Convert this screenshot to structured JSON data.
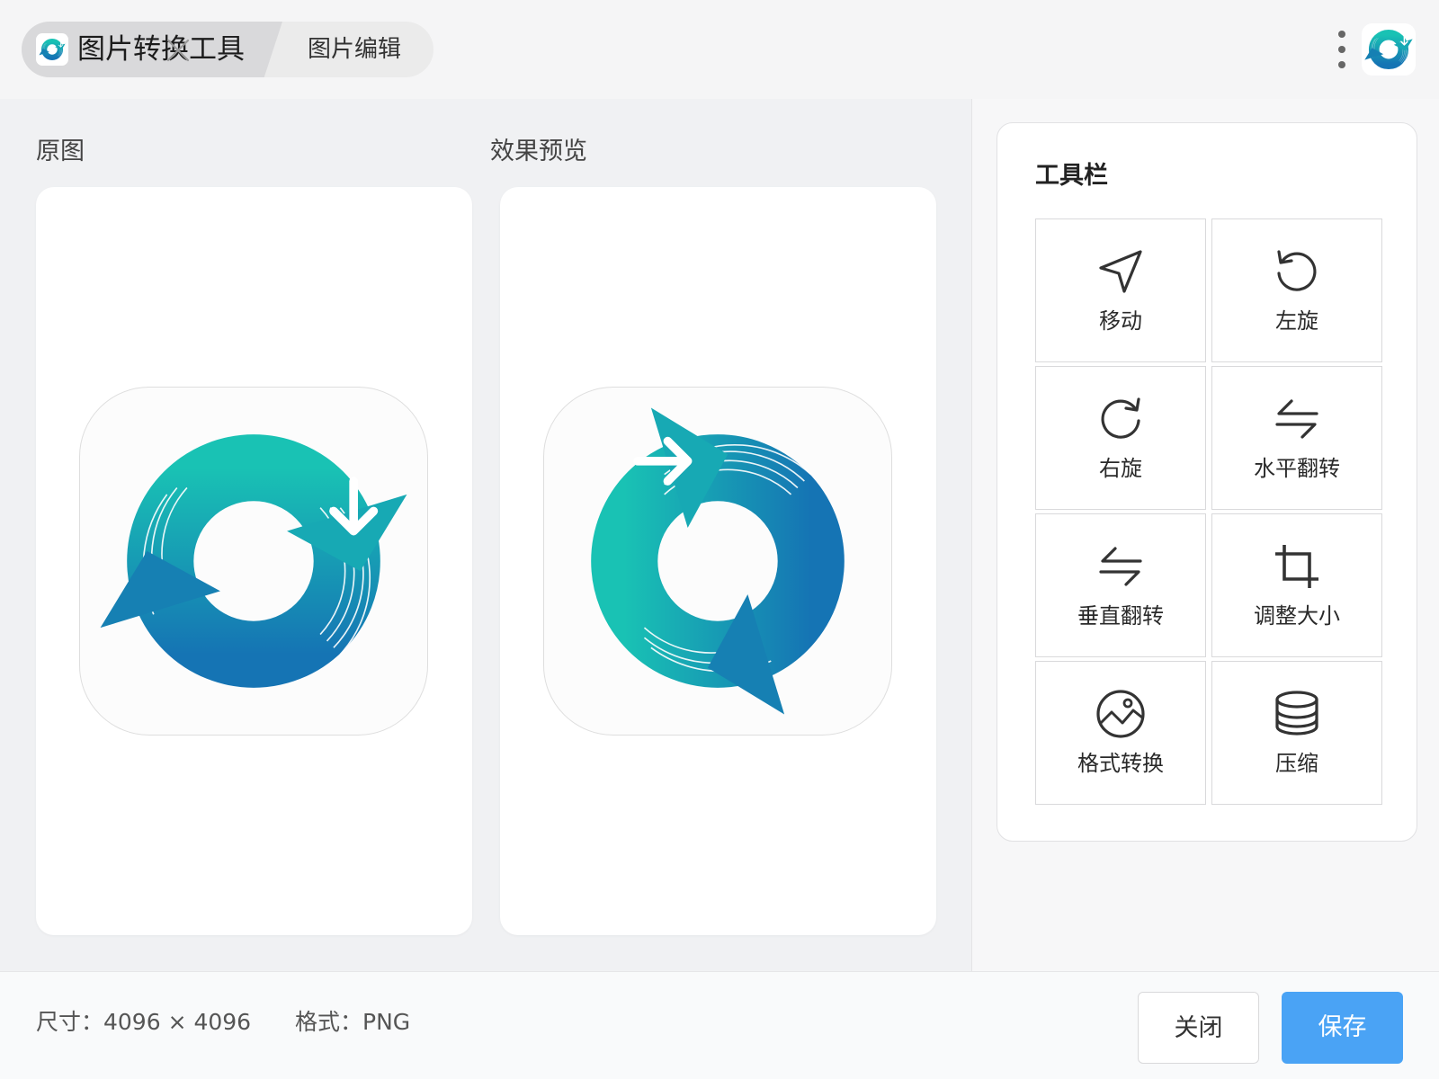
{
  "titlebar": {
    "app_tab_title": "图片转换工具",
    "second_tab_title": "图片编辑",
    "close_tab_icon": "close-icon",
    "more_icon": "vertical-dots-icon"
  },
  "main": {
    "original_label": "原图",
    "preview_label": "效果预览"
  },
  "toolbar": {
    "title": "工具栏",
    "tools": [
      {
        "label": "移动",
        "icon": "navigation-arrow-icon"
      },
      {
        "label": "左旋",
        "icon": "rotate-left-icon"
      },
      {
        "label": "右旋",
        "icon": "rotate-right-icon"
      },
      {
        "label": "水平翻转",
        "icon": "flip-horizontal-icon"
      },
      {
        "label": "垂直翻转",
        "icon": "flip-vertical-icon"
      },
      {
        "label": "调整大小",
        "icon": "crop-icon"
      },
      {
        "label": "格式转换",
        "icon": "image-format-icon"
      },
      {
        "label": "压缩",
        "icon": "compress-stack-icon"
      }
    ]
  },
  "footer": {
    "size_label": "尺寸：4096 × 4096",
    "format_label": "格式：PNG",
    "close_button": "关闭",
    "save_button": "保存"
  },
  "colors": {
    "accent_blue": "#4aa3f5",
    "logo_teal": "#19c2b4",
    "logo_blue": "#1574b4"
  }
}
